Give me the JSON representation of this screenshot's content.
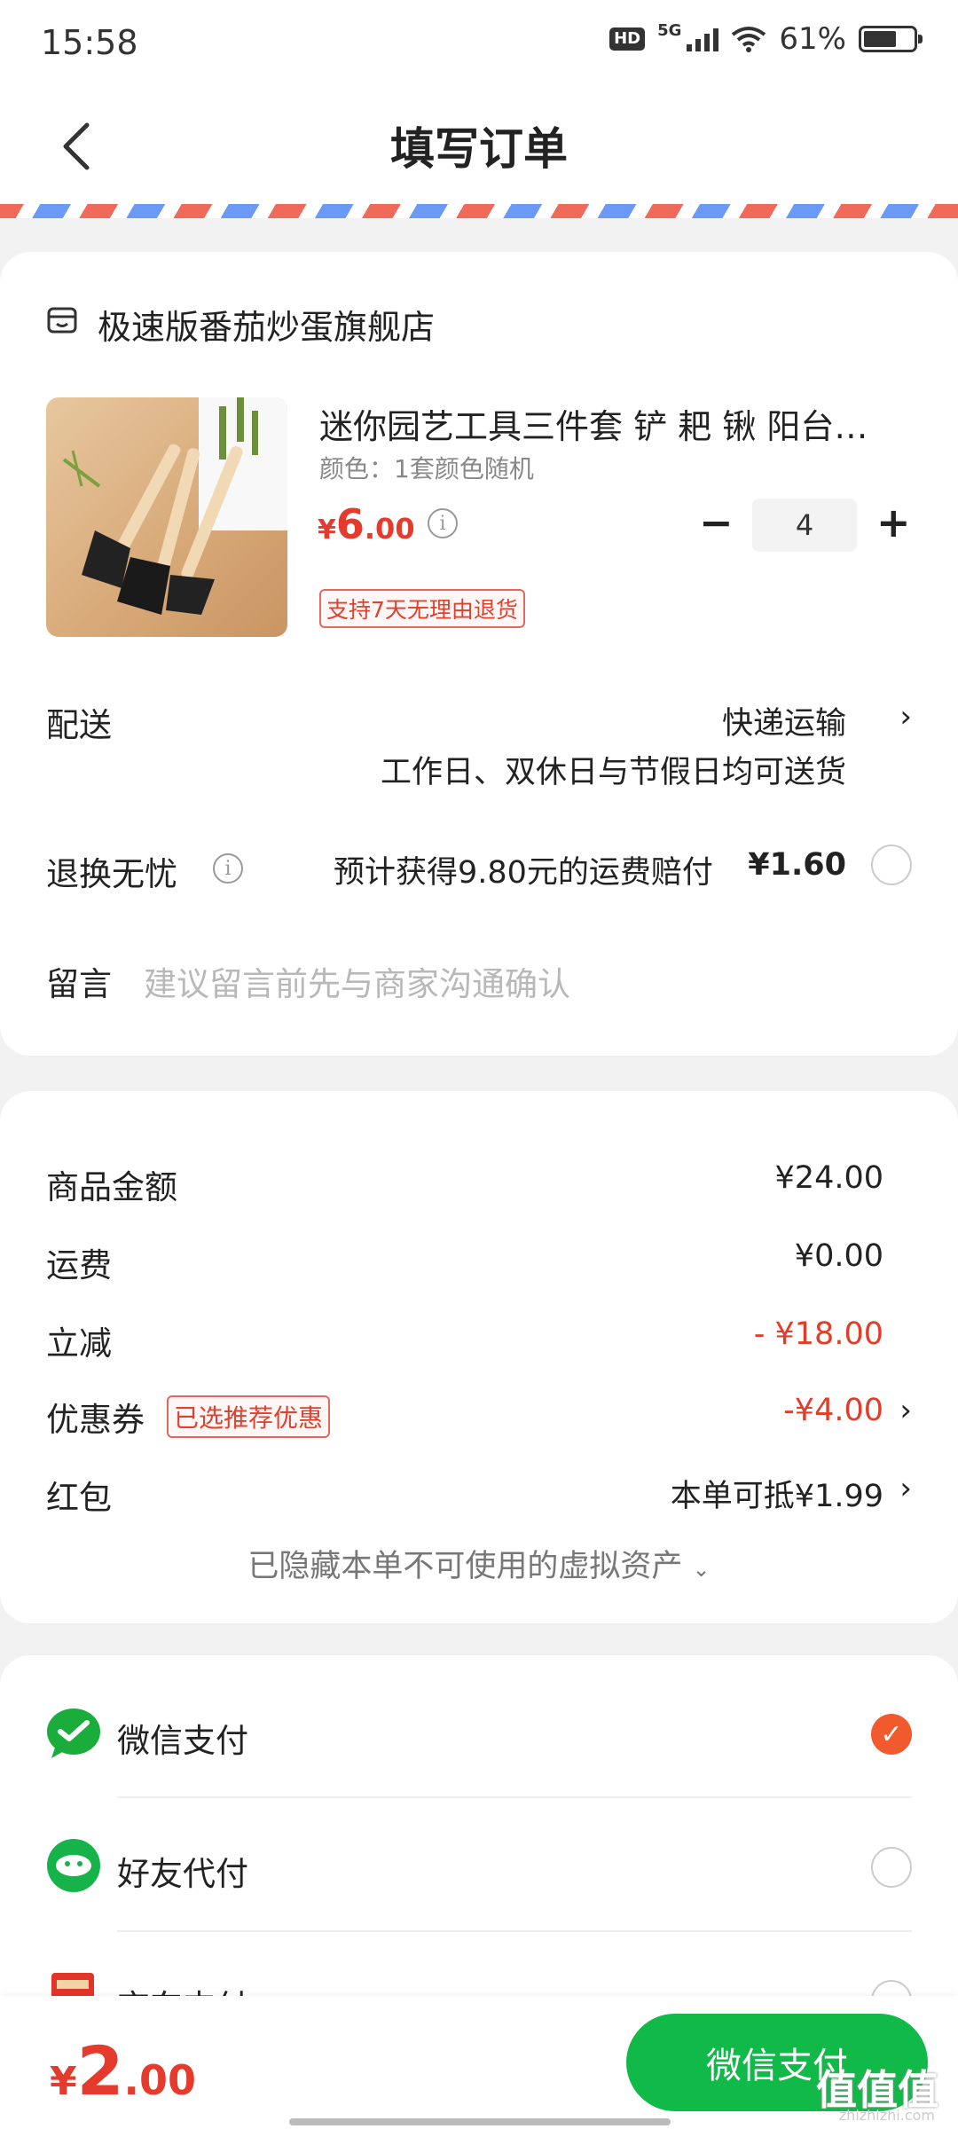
{
  "status_bar": {
    "time": "15:58",
    "network": "5G",
    "battery": "61%",
    "hd": "HD"
  },
  "header": {
    "title": "填写订单"
  },
  "store": {
    "name": "极速版番茄炒蛋旗舰店"
  },
  "product": {
    "name": "迷你园艺工具三件套 铲 耙 锹 阳台…",
    "spec": "颜色：1套颜色随机",
    "price_currency": "¥",
    "price_int": "6",
    "price_dec": ".00",
    "quantity": "4",
    "return_tag": "支持7天无理由退货"
  },
  "delivery": {
    "label": "配送",
    "method": "快递运输",
    "note": "工作日、双休日与节假日均可送货"
  },
  "return_worry_free": {
    "label": "退换无忧",
    "desc": "预计获得9.80元的运费赔付",
    "price": "¥1.60"
  },
  "message": {
    "label": "留言",
    "placeholder": "建议留言前先与商家沟通确认"
  },
  "summary": {
    "goods_label": "商品金额",
    "goods_value": "¥24.00",
    "shipping_label": "运费",
    "shipping_value": "¥0.00",
    "discount_label": "立减",
    "discount_value": "- ¥18.00",
    "coupon_label": "优惠券",
    "coupon_tag": "已选推荐优惠",
    "coupon_value": "-¥4.00",
    "redpacket_label": "红包",
    "redpacket_value": "本单可抵¥1.99",
    "hidden_assets": "已隐藏本单不可使用的虚拟资产"
  },
  "payment_methods": [
    {
      "label": "微信支付",
      "selected": true
    },
    {
      "label": "好友代付",
      "selected": false
    },
    {
      "label": "京东支付",
      "selected": false
    }
  ],
  "footer": {
    "currency": "¥",
    "total_int": "2",
    "total_dec": ".00",
    "pay_button": "微信支付"
  },
  "watermark": {
    "text": "值值值",
    "sub": "zhizhizhi.com"
  },
  "colors": {
    "accent_red": "#e53b2c",
    "wechat_green": "#10b948",
    "selected_orange": "#f05a2c"
  }
}
